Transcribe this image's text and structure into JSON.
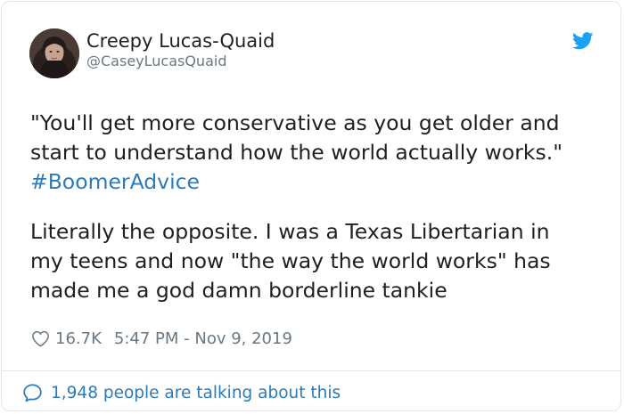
{
  "colors": {
    "link": "#2b7bb9",
    "muted": "#697882",
    "text": "#1c2022",
    "twitter_blue": "#1da1f2",
    "border": "#e1e8ed"
  },
  "author": {
    "display_name": "Creepy Lucas-Quaid",
    "handle": "@CaseyLucasQuaid",
    "avatar_icon": "profile-photo"
  },
  "tweet": {
    "line1": "\"You'll get more conservative as you get older and",
    "line2": "start to understand how the world actually works.\"",
    "hashtag": "#BoomerAdvice",
    "line4": "Literally the opposite. I was a Texas Libertarian in",
    "line5": "my teens and now \"the way the world works\" has",
    "line6": "made me a god damn borderline tankie"
  },
  "meta": {
    "heart_icon": "heart-outline",
    "likes": "16.7K",
    "timestamp": "5:47 PM - Nov 9, 2019"
  },
  "footer": {
    "icon": "speech-bubble",
    "text": "1,948 people are talking about this"
  }
}
